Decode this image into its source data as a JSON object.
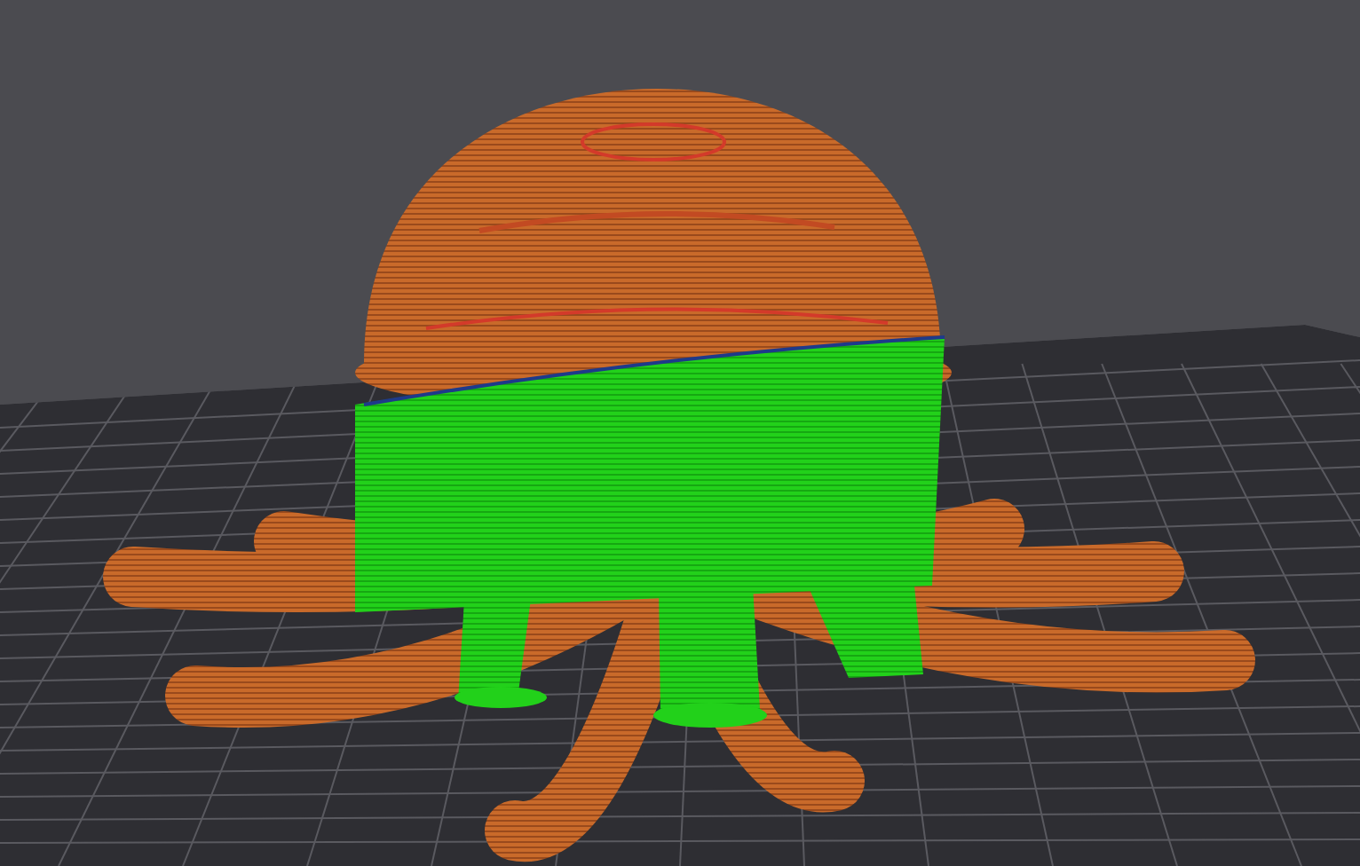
{
  "viewport": {
    "kind": "sliced-model-preview"
  }
}
